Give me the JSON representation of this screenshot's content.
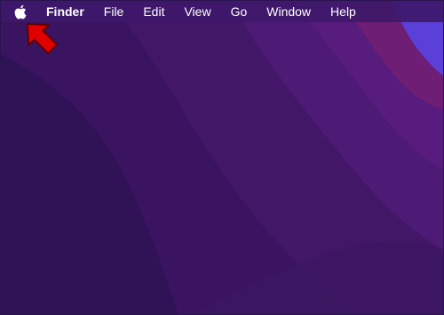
{
  "colors": {
    "menubar_bg": "#3e186a",
    "wallpaper_dark": "#351457",
    "wallpaper_mid": "#4b1a72",
    "wallpaper_light": "#5a1e80",
    "wallpaper_magenta": "#7a1f70",
    "wallpaper_blue": "#5a3fd8",
    "arrow_fill": "#e00000"
  },
  "menubar": {
    "apple_icon": "apple-logo-icon",
    "app_name": "Finder",
    "items": [
      {
        "label": "File"
      },
      {
        "label": "Edit"
      },
      {
        "label": "View"
      },
      {
        "label": "Go"
      },
      {
        "label": "Window"
      },
      {
        "label": "Help"
      }
    ]
  },
  "annotation": {
    "icon": "red-arrow-icon"
  }
}
